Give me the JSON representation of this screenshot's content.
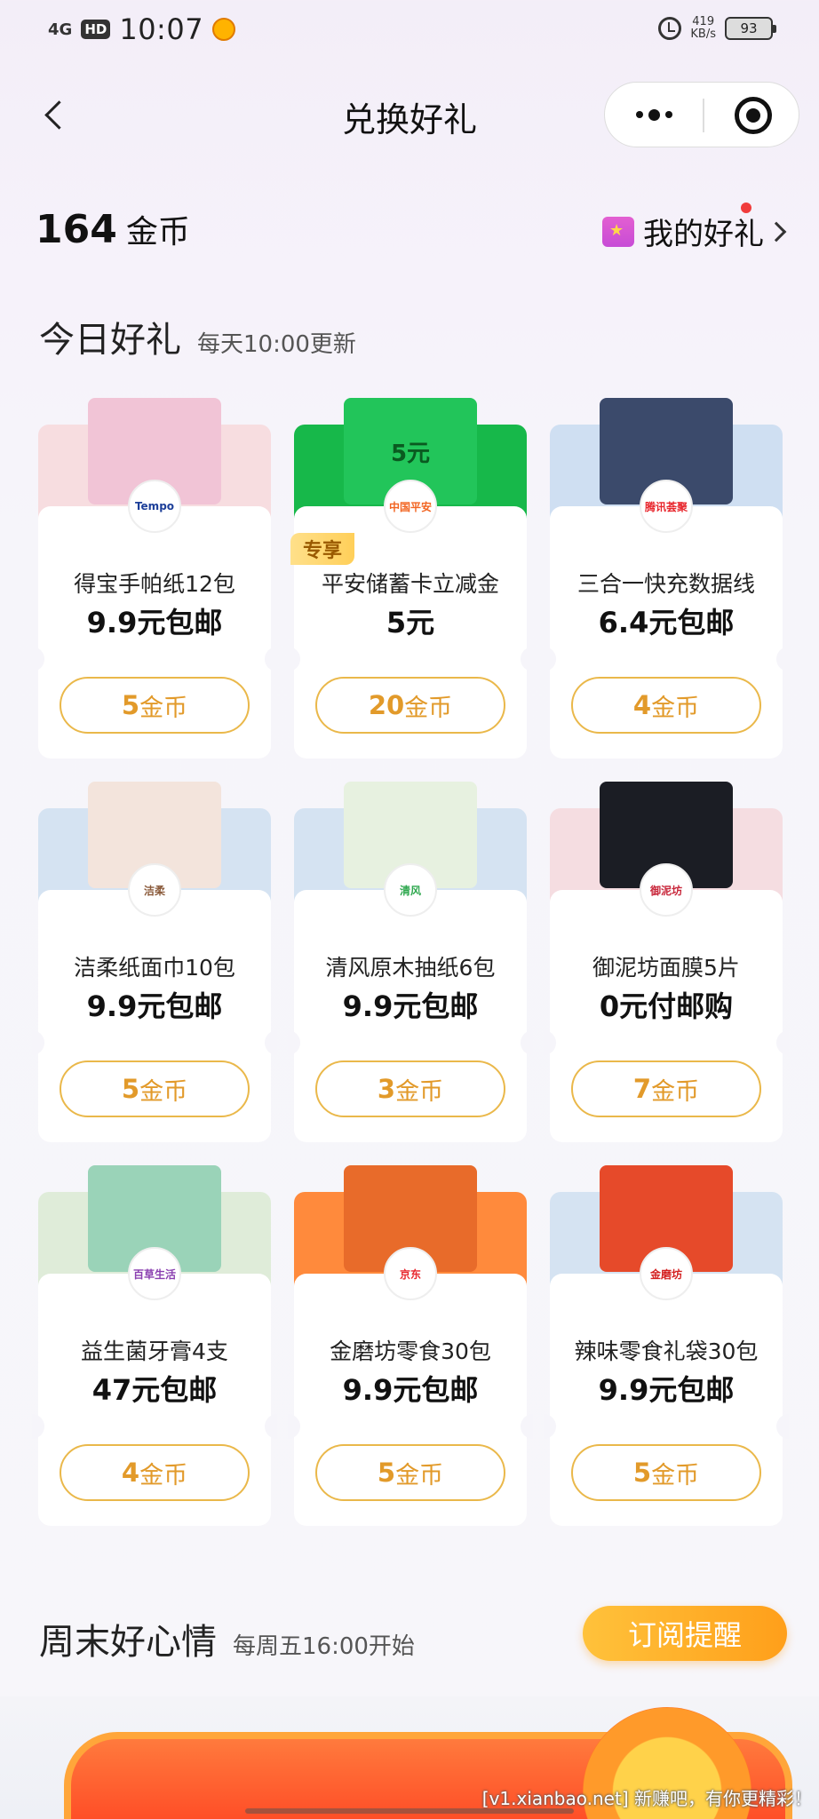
{
  "status_bar": {
    "network": "4G",
    "hd": "HD",
    "time": "10:07",
    "speed_value": "419",
    "speed_unit": "KB/s",
    "battery": "93"
  },
  "nav": {
    "title": "兑换好礼"
  },
  "wallet": {
    "coins": "164",
    "coin_unit": "金币",
    "my_gifts_label": "我的好礼"
  },
  "today": {
    "title": "今日好礼",
    "subtitle": "每天10:00更新",
    "items": [
      {
        "name": "得宝手帕纸12包",
        "price": "9.9元包邮",
        "cost": "5",
        "cost_unit": "金币",
        "brand": "Tempo",
        "banner_color": "#f7dde0",
        "product_color": "#f1c4d6",
        "logo_color": "#1d3f99"
      },
      {
        "name": "平安储蓄卡立减金",
        "price": "5元",
        "cost": "20",
        "cost_unit": "金币",
        "brand": "中国平安",
        "tag": "专享",
        "banner_color": "#17b84a",
        "product_color": "#22c55a",
        "logo_color": "#f26522",
        "product_text": "5元"
      },
      {
        "name": "三合一快充数据线",
        "price": "6.4元包邮",
        "cost": "4",
        "cost_unit": "金币",
        "brand": "腾讯荟聚",
        "banner_color": "#cfdff2",
        "product_color": "#3b4a6b",
        "logo_color": "#e8262d"
      },
      {
        "name": "洁柔纸面巾10包",
        "price": "9.9元包邮",
        "cost": "5",
        "cost_unit": "金币",
        "brand": "洁柔",
        "banner_color": "#d5e3f2",
        "product_color": "#f3e4dc",
        "logo_color": "#8a5a3a"
      },
      {
        "name": "清风原木抽纸6包",
        "price": "9.9元包邮",
        "cost": "3",
        "cost_unit": "金币",
        "brand": "清风",
        "banner_color": "#d5e3f2",
        "product_color": "#e7f1e0",
        "logo_color": "#2fa84f"
      },
      {
        "name": "御泥坊面膜5片",
        "price": "0元付邮购",
        "cost": "7",
        "cost_unit": "金币",
        "brand": "御泥坊",
        "banner_color": "#f5dde1",
        "product_color": "#1b1d24",
        "logo_color": "#c8263a"
      },
      {
        "name": "益生菌牙膏4支",
        "price": "47元包邮",
        "cost": "4",
        "cost_unit": "金币",
        "brand": "百草生活",
        "banner_color": "#dfecd9",
        "product_color": "#9ad3b8",
        "logo_color": "#8a3fb0"
      },
      {
        "name": "金磨坊零食30包",
        "price": "9.9元包邮",
        "cost": "5",
        "cost_unit": "金币",
        "brand": "京东",
        "banner_color": "#ff8a3c",
        "product_color": "#e86b2a",
        "logo_color": "#e8262d"
      },
      {
        "name": "辣味零食礼袋30包",
        "price": "9.9元包邮",
        "cost": "5",
        "cost_unit": "金币",
        "brand": "金磨坊",
        "banner_color": "#d5e3f2",
        "product_color": "#e64a2a",
        "logo_color": "#d41f1f"
      }
    ]
  },
  "weekend": {
    "title": "周末好心情",
    "subtitle": "每周五16:00开始",
    "subscribe_label": "订阅提醒"
  },
  "watermark": "[v1.xianbao.net] 新赚吧，有你更精彩！"
}
